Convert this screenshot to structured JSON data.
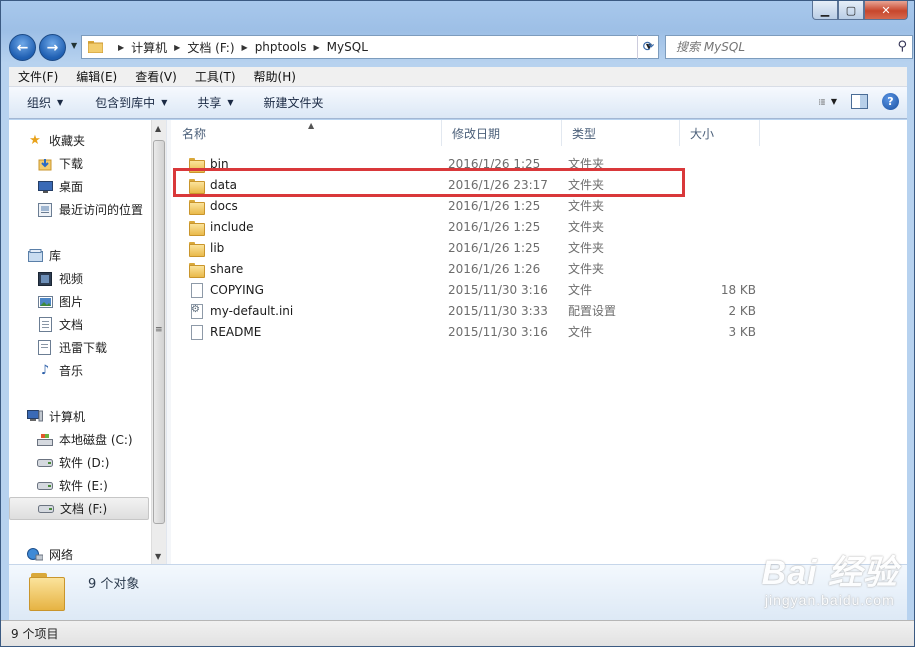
{
  "window": {
    "minimize": "▁",
    "maximize": "▢",
    "close": "✕"
  },
  "nav": {
    "back_icon": "back-arrow-icon",
    "forward_icon": "forward-arrow-icon",
    "breadcrumb": [
      "计算机",
      "文档 (F:)",
      "phptools",
      "MySQL"
    ],
    "search_placeholder": "搜索 MySQL"
  },
  "menubar": [
    "文件(F)",
    "编辑(E)",
    "查看(V)",
    "工具(T)",
    "帮助(H)"
  ],
  "commandbar": {
    "organize": "组织",
    "include_in_library": "包含到库中",
    "share": "共享",
    "new_folder": "新建文件夹"
  },
  "sidebar": {
    "favorites": {
      "label": "收藏夹",
      "items": [
        {
          "label": "下载",
          "icon": "download-folder-icon"
        },
        {
          "label": "桌面",
          "icon": "desktop-icon"
        },
        {
          "label": "最近访问的位置",
          "icon": "recent-places-icon"
        }
      ]
    },
    "libraries": {
      "label": "库",
      "items": [
        {
          "label": "视频",
          "icon": "video-library-icon"
        },
        {
          "label": "图片",
          "icon": "picture-library-icon"
        },
        {
          "label": "文档",
          "icon": "document-library-icon"
        },
        {
          "label": "迅雷下载",
          "icon": "thunder-download-icon"
        },
        {
          "label": "音乐",
          "icon": "music-library-icon"
        }
      ]
    },
    "computer": {
      "label": "计算机",
      "items": [
        {
          "label": "本地磁盘 (C:)",
          "icon": "system-drive-icon"
        },
        {
          "label": "软件 (D:)",
          "icon": "drive-icon"
        },
        {
          "label": "软件 (E:)",
          "icon": "drive-icon"
        },
        {
          "label": "文档 (F:)",
          "icon": "drive-icon",
          "selected": true
        }
      ]
    },
    "network": {
      "label": "网络"
    }
  },
  "columns": {
    "name": "名称",
    "date": "修改日期",
    "type": "类型",
    "size": "大小"
  },
  "files": [
    {
      "name": "bin",
      "date": "2016/1/26 1:25",
      "type": "文件夹",
      "size": "",
      "kind": "folder"
    },
    {
      "name": "data",
      "date": "2016/1/26 23:17",
      "type": "文件夹",
      "size": "",
      "kind": "folder",
      "highlighted": true
    },
    {
      "name": "docs",
      "date": "2016/1/26 1:25",
      "type": "文件夹",
      "size": "",
      "kind": "folder"
    },
    {
      "name": "include",
      "date": "2016/1/26 1:25",
      "type": "文件夹",
      "size": "",
      "kind": "folder"
    },
    {
      "name": "lib",
      "date": "2016/1/26 1:25",
      "type": "文件夹",
      "size": "",
      "kind": "folder"
    },
    {
      "name": "share",
      "date": "2016/1/26 1:26",
      "type": "文件夹",
      "size": "",
      "kind": "folder"
    },
    {
      "name": "COPYING",
      "date": "2015/11/30 3:16",
      "type": "文件",
      "size": "18 KB",
      "kind": "file"
    },
    {
      "name": "my-default.ini",
      "date": "2015/11/30 3:33",
      "type": "配置设置",
      "size": "2 KB",
      "kind": "cfg"
    },
    {
      "name": "README",
      "date": "2015/11/30 3:16",
      "type": "文件",
      "size": "3 KB",
      "kind": "file"
    }
  ],
  "details": {
    "summary": "9 个对象"
  },
  "status": {
    "text": "9 个项目"
  },
  "watermark": {
    "main": "Bai 经验",
    "sub": "jingyan.baidu.com"
  },
  "colors": {
    "highlight": "#d9383a",
    "titlebar": "#9dbfe6",
    "folder": "#e9b94a"
  }
}
